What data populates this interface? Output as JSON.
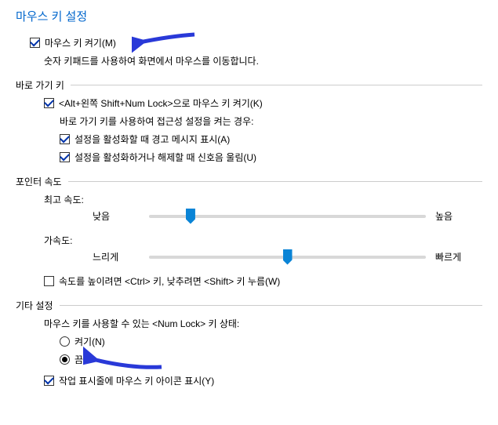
{
  "title": "마우스 키 설정",
  "mouseKeys": {
    "enable": {
      "label": "마우스 키 켜기(M)",
      "checked": true
    },
    "description": "숫자 키패드를 사용하여 화면에서 마우스를 이동합니다."
  },
  "shortcut": {
    "groupLabel": "바로 가기 키",
    "altShift": {
      "label": "<Alt+왼쪽 Shift+Num Lock>으로 마우스 키 켜기(K)",
      "checked": true
    },
    "subDescription": "바로 가기 키를 사용하여 접근성 설정을 켜는 경우:",
    "warn": {
      "label": "설정을 활성화할 때 경고 메시지 표시(A)",
      "checked": true
    },
    "sound": {
      "label": "설정을 활성화하거나 해제할 때 신호음 울림(U)",
      "checked": true
    }
  },
  "speed": {
    "groupLabel": "포인터 속도",
    "topSpeed": {
      "label": "최고 속도:",
      "low": "낮음",
      "high": "높음",
      "value": 15
    },
    "accel": {
      "label": "가속도:",
      "slow": "느리게",
      "fast": "빠르게",
      "value": 50
    },
    "ctrlShift": {
      "label": "속도를 높이려면 <Ctrl> 키, 낮추려면 <Shift> 키 누름(W)",
      "checked": false
    }
  },
  "other": {
    "groupLabel": "기타 설정",
    "numlockDesc": "마우스 키를 사용할 수 있는 <Num Lock> 키 상태:",
    "on": {
      "label": "켜기(N)",
      "selected": false
    },
    "off": {
      "label": "끔",
      "selected": true
    },
    "tray": {
      "label": "작업 표시줄에 마우스 키 아이콘 표시(Y)",
      "checked": true
    }
  },
  "annotations": {
    "arrowColor": "#2939d8"
  }
}
